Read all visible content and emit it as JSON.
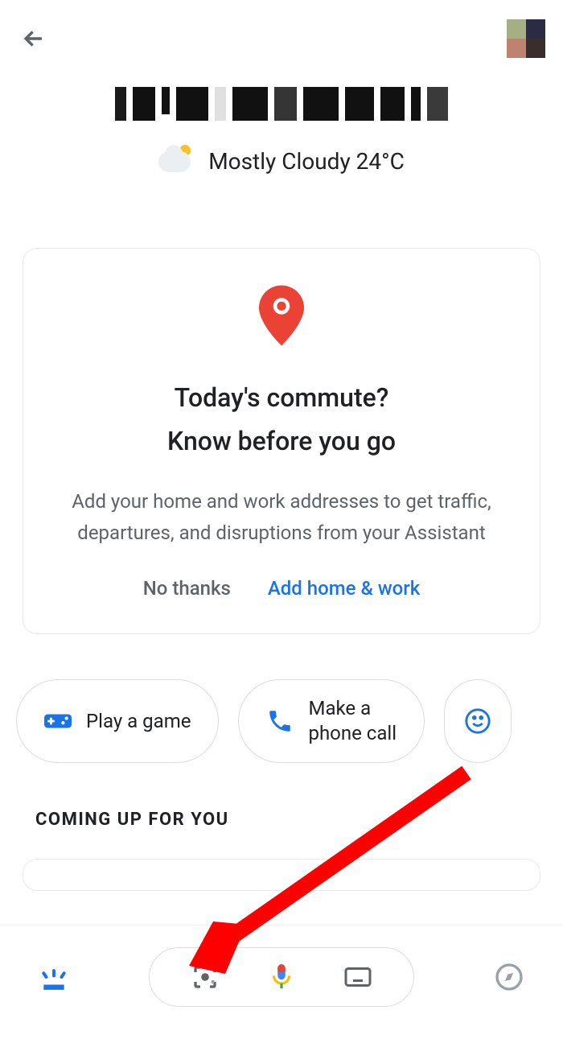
{
  "header": {
    "back_icon": "back-arrow",
    "avatar": "profile"
  },
  "weather": {
    "summary": "Mostly Cloudy 24°C"
  },
  "commute_card": {
    "title_line1": "Today's commute?",
    "title_line2": "Know before you go",
    "body": "Add your home and work addresses to get traffic, departures, and disruptions from your Assistant",
    "no_thanks": "No thanks",
    "add": "Add home & work"
  },
  "chips": {
    "play_game": "Play a game",
    "phone_call_1": "Make a",
    "phone_call_2": "phone call"
  },
  "section_title": "COMING UP FOR YOU",
  "bottom": {
    "updates_icon": "updates",
    "lens_icon": "lens",
    "mic_icon": "voice",
    "keyboard_icon": "keyboard",
    "explore_icon": "explore"
  }
}
